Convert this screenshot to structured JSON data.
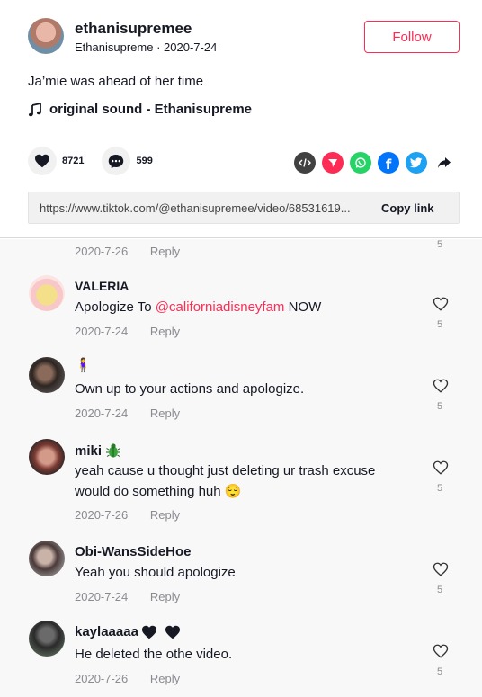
{
  "post": {
    "username": "ethanisupremee",
    "display_name": "Ethanisupreme",
    "date": "2020-7-24",
    "follow_label": "Follow",
    "caption": "Ja’mie was ahead of her time",
    "sound": "original sound - Ethanisupreme",
    "likes": "8721",
    "comments_count": "599",
    "link": "https://www.tiktok.com/@ethanisupremee/video/68531619...",
    "copy_link_label": "Copy link"
  },
  "share_icons": [
    "embed-icon",
    "send-icon",
    "whatsapp-icon",
    "facebook-icon",
    "twitter-icon",
    "share-arrow-icon"
  ],
  "reply_label": "Reply",
  "partial_comment": {
    "date": "2020-7-26",
    "likes": "5"
  },
  "comments": [
    {
      "name": "VALERIA",
      "text_before": "Apologize To ",
      "mention": "@californiadisneyfam",
      "text_after": " NOW",
      "date": "2020-7-24",
      "likes": "5"
    },
    {
      "name": "",
      "name_emoji": "🧍‍♀️",
      "text": "Own up to your actions and apologize.",
      "date": "2020-7-24",
      "likes": "5"
    },
    {
      "name": "miki",
      "text": "yeah cause u thought just deleting ur trash excuse would do something huh 😌",
      "date": "2020-7-26",
      "likes": "5"
    },
    {
      "name": "Obi-WansSideHoe",
      "text": "Yeah you should apologize",
      "date": "2020-7-24",
      "likes": "5"
    },
    {
      "name": "kaylaaaaa",
      "text": "He deleted the othe video.",
      "date": "2020-7-26",
      "likes": "5"
    }
  ]
}
